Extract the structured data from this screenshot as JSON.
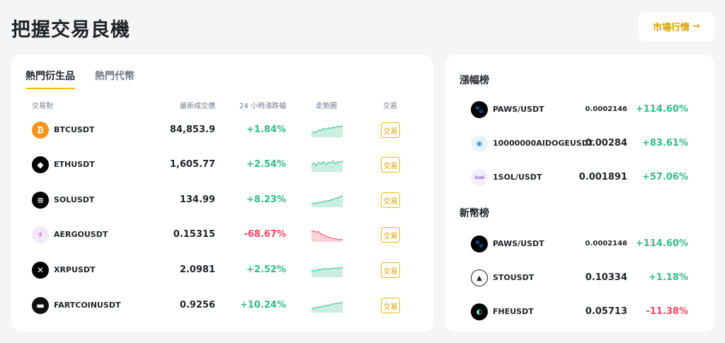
{
  "header": {
    "title": "把握交易良機",
    "market_button_label": "市場行情",
    "market_button_arrow": "→"
  },
  "tabs": [
    {
      "label": "熱門衍生品",
      "active": true
    },
    {
      "label": "熱門代幣",
      "active": false
    }
  ],
  "table": {
    "columns": {
      "pair": "交易對",
      "price": "最新成交價",
      "change": "24 小時漲跌幅",
      "chart": "走勢圖",
      "trade": "交易"
    },
    "trade_label": "交易",
    "rows": [
      {
        "icon": "bitcoin-icon",
        "glyph": "₿",
        "color": "#f7931a",
        "pair": "BTCUSDT",
        "price": "84,853.9",
        "change": "+1.84%",
        "trend": "up",
        "spark": [
          5,
          7,
          6,
          9,
          8,
          11,
          10,
          12,
          11,
          13,
          12,
          14,
          13,
          15
        ]
      },
      {
        "icon": "ethereum-icon",
        "glyph": "◆",
        "color": "#000000",
        "pair": "ETHUSDT",
        "price": "1,605.77",
        "change": "+2.54%",
        "trend": "up",
        "spark": [
          9,
          11,
          8,
          12,
          10,
          13,
          9,
          12,
          11,
          14,
          10,
          13,
          12,
          14
        ]
      },
      {
        "icon": "solana-icon",
        "glyph": "≡",
        "color": "#000000",
        "pair": "SOLUSDT",
        "price": "134.99",
        "change": "+8.23%",
        "trend": "up",
        "spark": [
          4,
          5,
          5,
          6,
          6,
          7,
          8,
          8,
          9,
          10,
          11,
          12,
          13,
          15
        ]
      },
      {
        "icon": "aergo-icon",
        "glyph": "⚡",
        "color": "#f1e9f7",
        "pair": "AERGOUSDT",
        "price": "0.15315",
        "change": "-68.67%",
        "trend": "down",
        "spark": [
          13,
          14,
          12,
          13,
          10,
          9,
          7,
          6,
          5,
          4,
          4,
          3,
          3,
          3
        ]
      },
      {
        "icon": "xrp-icon",
        "glyph": "✕",
        "color": "#000000",
        "pair": "XRPUSDT",
        "price": "2.0981",
        "change": "+2.52%",
        "trend": "up",
        "spark": [
          7,
          9,
          8,
          10,
          9,
          11,
          10,
          11,
          10,
          12,
          11,
          12,
          11,
          13
        ]
      },
      {
        "icon": "fartcoin-icon",
        "glyph": "▬",
        "color": "#111111",
        "pair": "FARTCOINUSDT",
        "price": "0.9256",
        "change": "+10.24%",
        "trend": "up",
        "spark": [
          5,
          6,
          6,
          7,
          7,
          8,
          9,
          9,
          10,
          11,
          11,
          12,
          12,
          13
        ]
      }
    ]
  },
  "gainers": {
    "title": "漲幅榜",
    "items": [
      {
        "icon": "paws-icon",
        "glyph": "🐾",
        "bg": "#000000",
        "fg": "#ffffff",
        "pair": "PAWS/USDT",
        "price": "0.0002146",
        "price_size": "small",
        "change": "+114.60%",
        "trend": "up"
      },
      {
        "icon": "aidoge-icon",
        "glyph": "◉",
        "bg": "#e8f4fb",
        "fg": "#3b8fd4",
        "pair": "10000000AIDOGEUSDT",
        "price": "0.00284",
        "price_size": "large",
        "change": "+83.61%",
        "trend": "up"
      },
      {
        "icon": "1sol-icon",
        "glyph": "1sol",
        "bg": "#f3eefc",
        "fg": "#7a4fd1",
        "pair": "1SOL/USDT",
        "price": "0.001891",
        "price_size": "large",
        "change": "+57.06%",
        "trend": "up"
      }
    ]
  },
  "new_listings": {
    "title": "新幣榜",
    "items": [
      {
        "icon": "paws-icon",
        "glyph": "🐾",
        "bg": "#000000",
        "fg": "#ffffff",
        "pair": "PAWS/USDT",
        "price": "0.0002146",
        "price_size": "small",
        "change": "+114.60%",
        "trend": "up"
      },
      {
        "icon": "sto-icon",
        "glyph": "▲",
        "bg": "#ffffff",
        "fg": "#1e2329",
        "pair": "STOUSDT",
        "price": "0.10334",
        "price_size": "large",
        "change": "+1.18%",
        "trend": "up"
      },
      {
        "icon": "fhe-icon",
        "glyph": "◐",
        "bg": "#000000",
        "fg": "#7fe3c9",
        "pair": "FHEUSDT",
        "price": "0.05713",
        "price_size": "large",
        "change": "-11.38%",
        "trend": "down"
      }
    ]
  },
  "colors": {
    "up": "#2ebd85",
    "down": "#f6465d",
    "accent": "#f0b90b"
  }
}
